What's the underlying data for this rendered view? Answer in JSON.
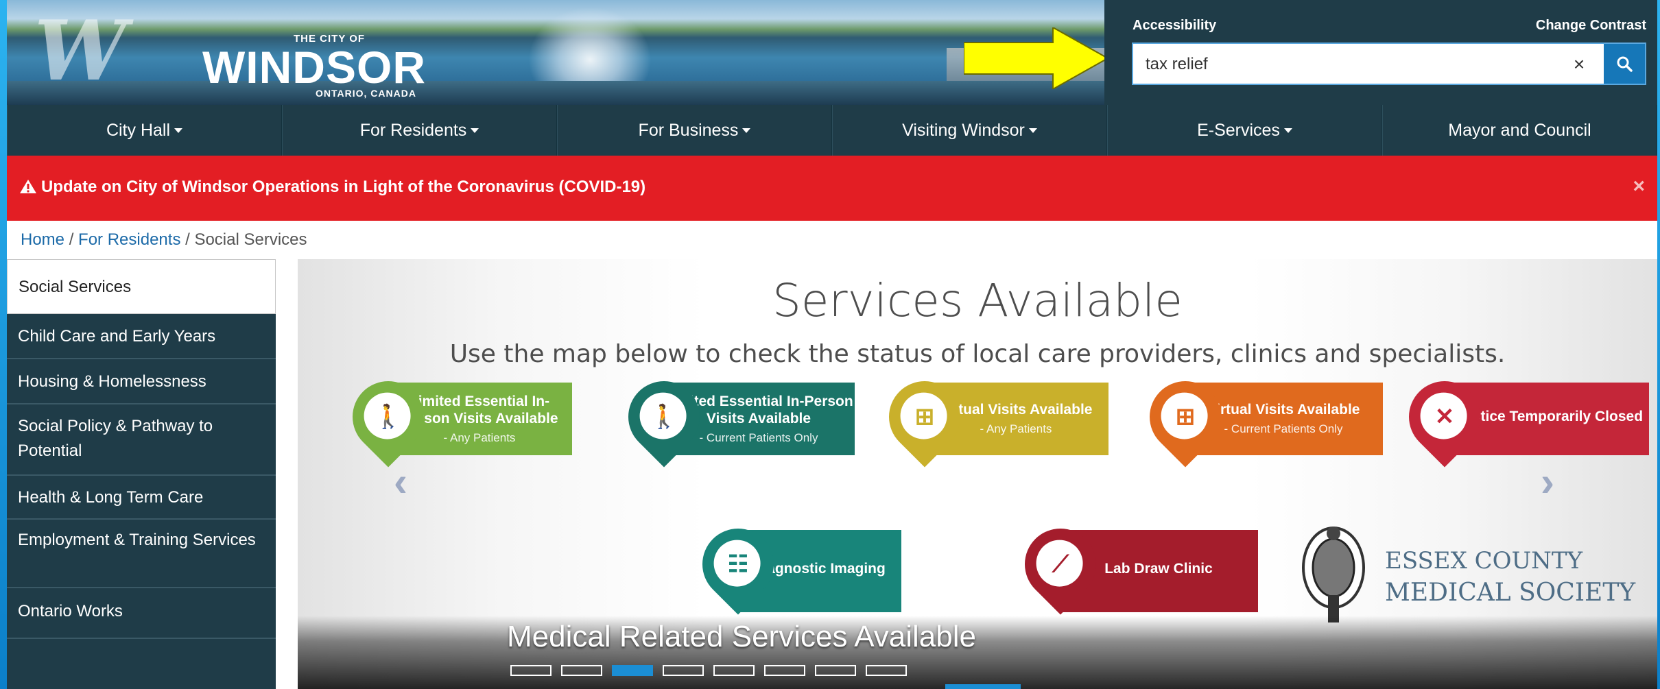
{
  "header": {
    "logo": {
      "line1": "THE CITY OF",
      "line2": "WINDSOR",
      "line3": "ONTARIO, CANADA"
    },
    "accessibility": "Accessibility",
    "change_contrast": "Change Contrast",
    "search": {
      "value": "tax relief",
      "clear_symbol": "×"
    },
    "arrow_color": "#ffff00"
  },
  "nav": {
    "items": [
      {
        "label": "City Hall",
        "dropdown": true
      },
      {
        "label": "For Residents",
        "dropdown": true
      },
      {
        "label": "For Business",
        "dropdown": true
      },
      {
        "label": "Visiting Windsor",
        "dropdown": true
      },
      {
        "label": "E-Services",
        "dropdown": true
      },
      {
        "label": "Mayor and Council",
        "dropdown": false
      }
    ]
  },
  "alert": {
    "text": "Update on City of Windsor Operations in Light of the Coronavirus (COVID-19)",
    "close": "×"
  },
  "breadcrumb": {
    "home": "Home",
    "sep": "/",
    "residents": "For Residents",
    "current": "Social Services"
  },
  "sidebar": {
    "items": [
      {
        "label": "Social Services",
        "active": true
      },
      {
        "label": "Child Care and Early Years"
      },
      {
        "label": "Housing & Homelessness"
      },
      {
        "label": "Social Policy & Pathway to Potential"
      },
      {
        "label": "Health & Long Term Care"
      },
      {
        "label": "Employment & Training Services"
      },
      {
        "label": "Ontario Works"
      }
    ]
  },
  "slide": {
    "title": "Services Available",
    "subtitle": "Use the map below to check the status of local care providers, clinics and specialists.",
    "badges": [
      {
        "title": "Limited Essential In-Person Visits Available",
        "sub": "- Any Patients",
        "color": "#7ab242"
      },
      {
        "title": "Limited Essential In-Person Visits Available",
        "sub": "- Current Patients Only",
        "color": "#1b7468"
      },
      {
        "title": "Virtual Visits Available",
        "sub": "- Any Patients",
        "color": "#c9b02b"
      },
      {
        "title": "Virtual Visits Available",
        "sub": "- Current Patients Only",
        "color": "#e06a1e"
      },
      {
        "title": "Practice Temporarily Closed",
        "sub": "",
        "color": "#c42639"
      },
      {
        "title": "Diagnostic Imaging",
        "sub": "",
        "color": "#18857a"
      },
      {
        "title": "Lab Draw Clinic",
        "sub": "",
        "color": "#a41d2c"
      }
    ],
    "essex_line1": "ESSEX COUNTY",
    "essex_line2": "MEDICAL SOCIETY",
    "caption": "Medical Related Services Available",
    "dots_total": 8,
    "dots_active_index": 2
  }
}
